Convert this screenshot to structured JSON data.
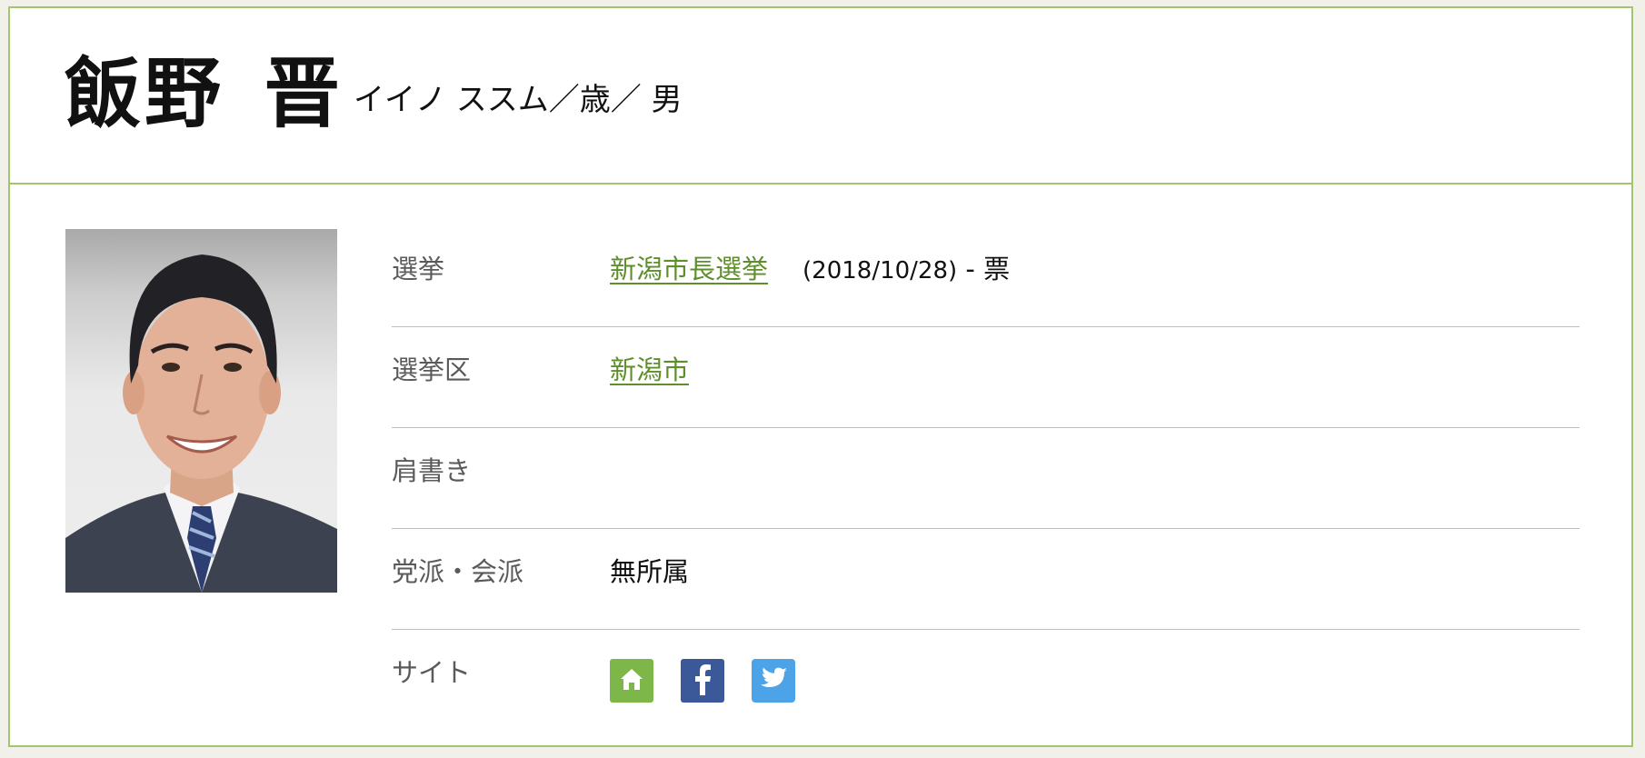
{
  "profile": {
    "name": "飯野 晋",
    "kana": "イイノ ススム／歳／ 男"
  },
  "details": {
    "election_label": "選挙",
    "election_link": "新潟市長選挙",
    "election_date": "(2018/10/28)",
    "election_votes": "- 票",
    "district_label": "選挙区",
    "district_link": "新潟市",
    "title_label": "肩書き",
    "title_value": "",
    "party_label": "党派・会派",
    "party_value": "無所属",
    "site_label": "サイト"
  },
  "icons": {
    "home": "home-icon",
    "facebook": "facebook-icon",
    "twitter": "twitter-icon"
  },
  "colors": {
    "accent_border": "#a3c66d",
    "link": "#5e8f2b",
    "home_button": "#7db649",
    "facebook_button": "#3b5998",
    "twitter_button": "#4da3e8"
  }
}
